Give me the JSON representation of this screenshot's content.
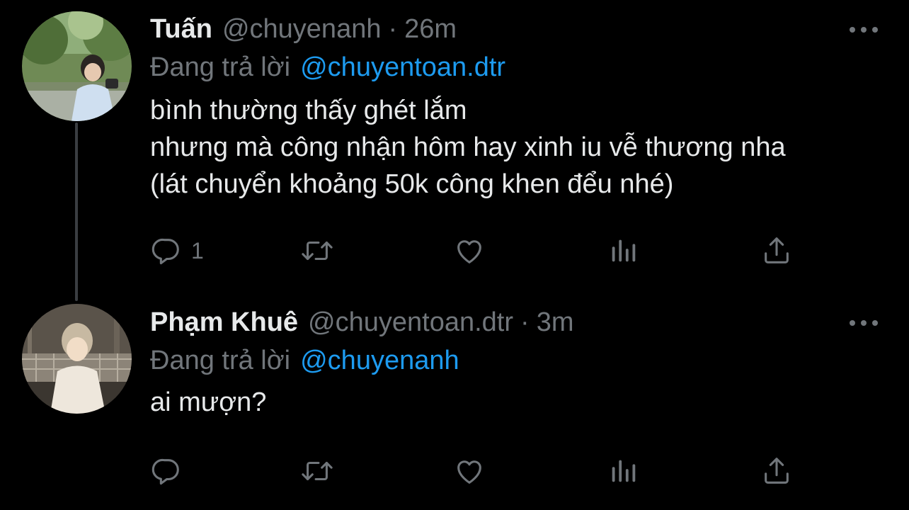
{
  "colors": {
    "background": "#000000",
    "text_primary": "#e7e9ea",
    "text_secondary": "#71767b",
    "link": "#1d9bf0"
  },
  "tweets": [
    {
      "display_name": "Tuấn",
      "handle": "@chuyenanh",
      "separator": "·",
      "time": "26m",
      "reply_prefix": "Đang trả lời",
      "reply_to": "@chuyentoan.dtr",
      "text_lines": [
        "bình thường thấy ghét lắm",
        "nhưng mà công nhận hôm hay xinh iu vễ thương nha",
        "(lát chuyển khoảng 50k công khen đểu nhé)"
      ],
      "reply_count": "1",
      "icons": [
        "reply-icon",
        "retweet-icon",
        "like-icon",
        "views-icon",
        "share-icon",
        "more-icon"
      ]
    },
    {
      "display_name": "Phạm Khuê",
      "handle": "@chuyentoan.dtr",
      "separator": "·",
      "time": "3m",
      "reply_prefix": "Đang trả lời",
      "reply_to": "@chuyenanh",
      "text_lines": [
        "ai mượn?"
      ],
      "reply_count": "",
      "icons": [
        "reply-icon",
        "retweet-icon",
        "like-icon",
        "views-icon",
        "share-icon",
        "more-icon"
      ]
    }
  ]
}
